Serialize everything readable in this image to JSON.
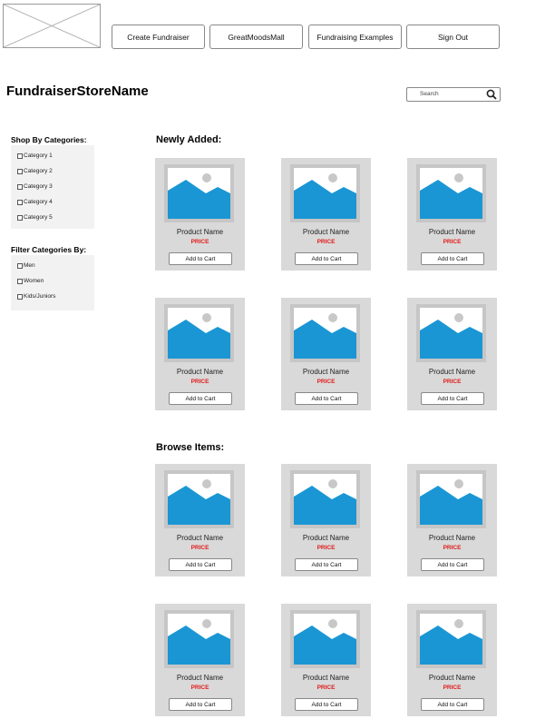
{
  "header": {
    "nav": [
      "Create Fundraiser",
      "GreatMoodsMall",
      "Fundraising Examples",
      "Sign Out"
    ],
    "store_name": "FundraiserStoreName",
    "search_placeholder": "Search"
  },
  "sidebar": {
    "shop_title": "Shop By Categories:",
    "categories": [
      "Category 1",
      "Category 2",
      "Category 3",
      "Category 4",
      "Category 5"
    ],
    "filter_title": "Filter Categories By:",
    "filters": [
      "Men",
      "Women",
      "Kids/Juniors"
    ]
  },
  "sections": [
    {
      "title": "Newly Added:",
      "products": [
        {
          "name": "Product Name",
          "price": "PRICE",
          "button": "Add to Cart"
        },
        {
          "name": "Product Name",
          "price": "PRICE",
          "button": "Add to Cart"
        },
        {
          "name": "Product Name",
          "price": "PRICE",
          "button": "Add to Cart"
        },
        {
          "name": "Product Name",
          "price": "PRICE",
          "button": "Add to Cart"
        },
        {
          "name": "Product Name",
          "price": "PRICE",
          "button": "Add to Cart"
        },
        {
          "name": "Product Name",
          "price": "PRICE",
          "button": "Add to Cart"
        }
      ]
    },
    {
      "title": "Browse Items:",
      "products": [
        {
          "name": "Product Name",
          "price": "PRICE",
          "button": "Add to Cart"
        },
        {
          "name": "Product Name",
          "price": "PRICE",
          "button": "Add to Cart"
        },
        {
          "name": "Product Name",
          "price": "PRICE",
          "button": "Add to Cart"
        },
        {
          "name": "Product Name",
          "price": "PRICE",
          "button": "Add to Cart"
        },
        {
          "name": "Product Name",
          "price": "PRICE",
          "button": "Add to Cart"
        },
        {
          "name": "Product Name",
          "price": "PRICE",
          "button": "Add to Cart"
        }
      ]
    }
  ],
  "colors": {
    "price": "#e31b1b",
    "image_placeholder": "#1a96d4",
    "card_background": "#d9d9d9",
    "panel_background": "#f2f2f2"
  }
}
